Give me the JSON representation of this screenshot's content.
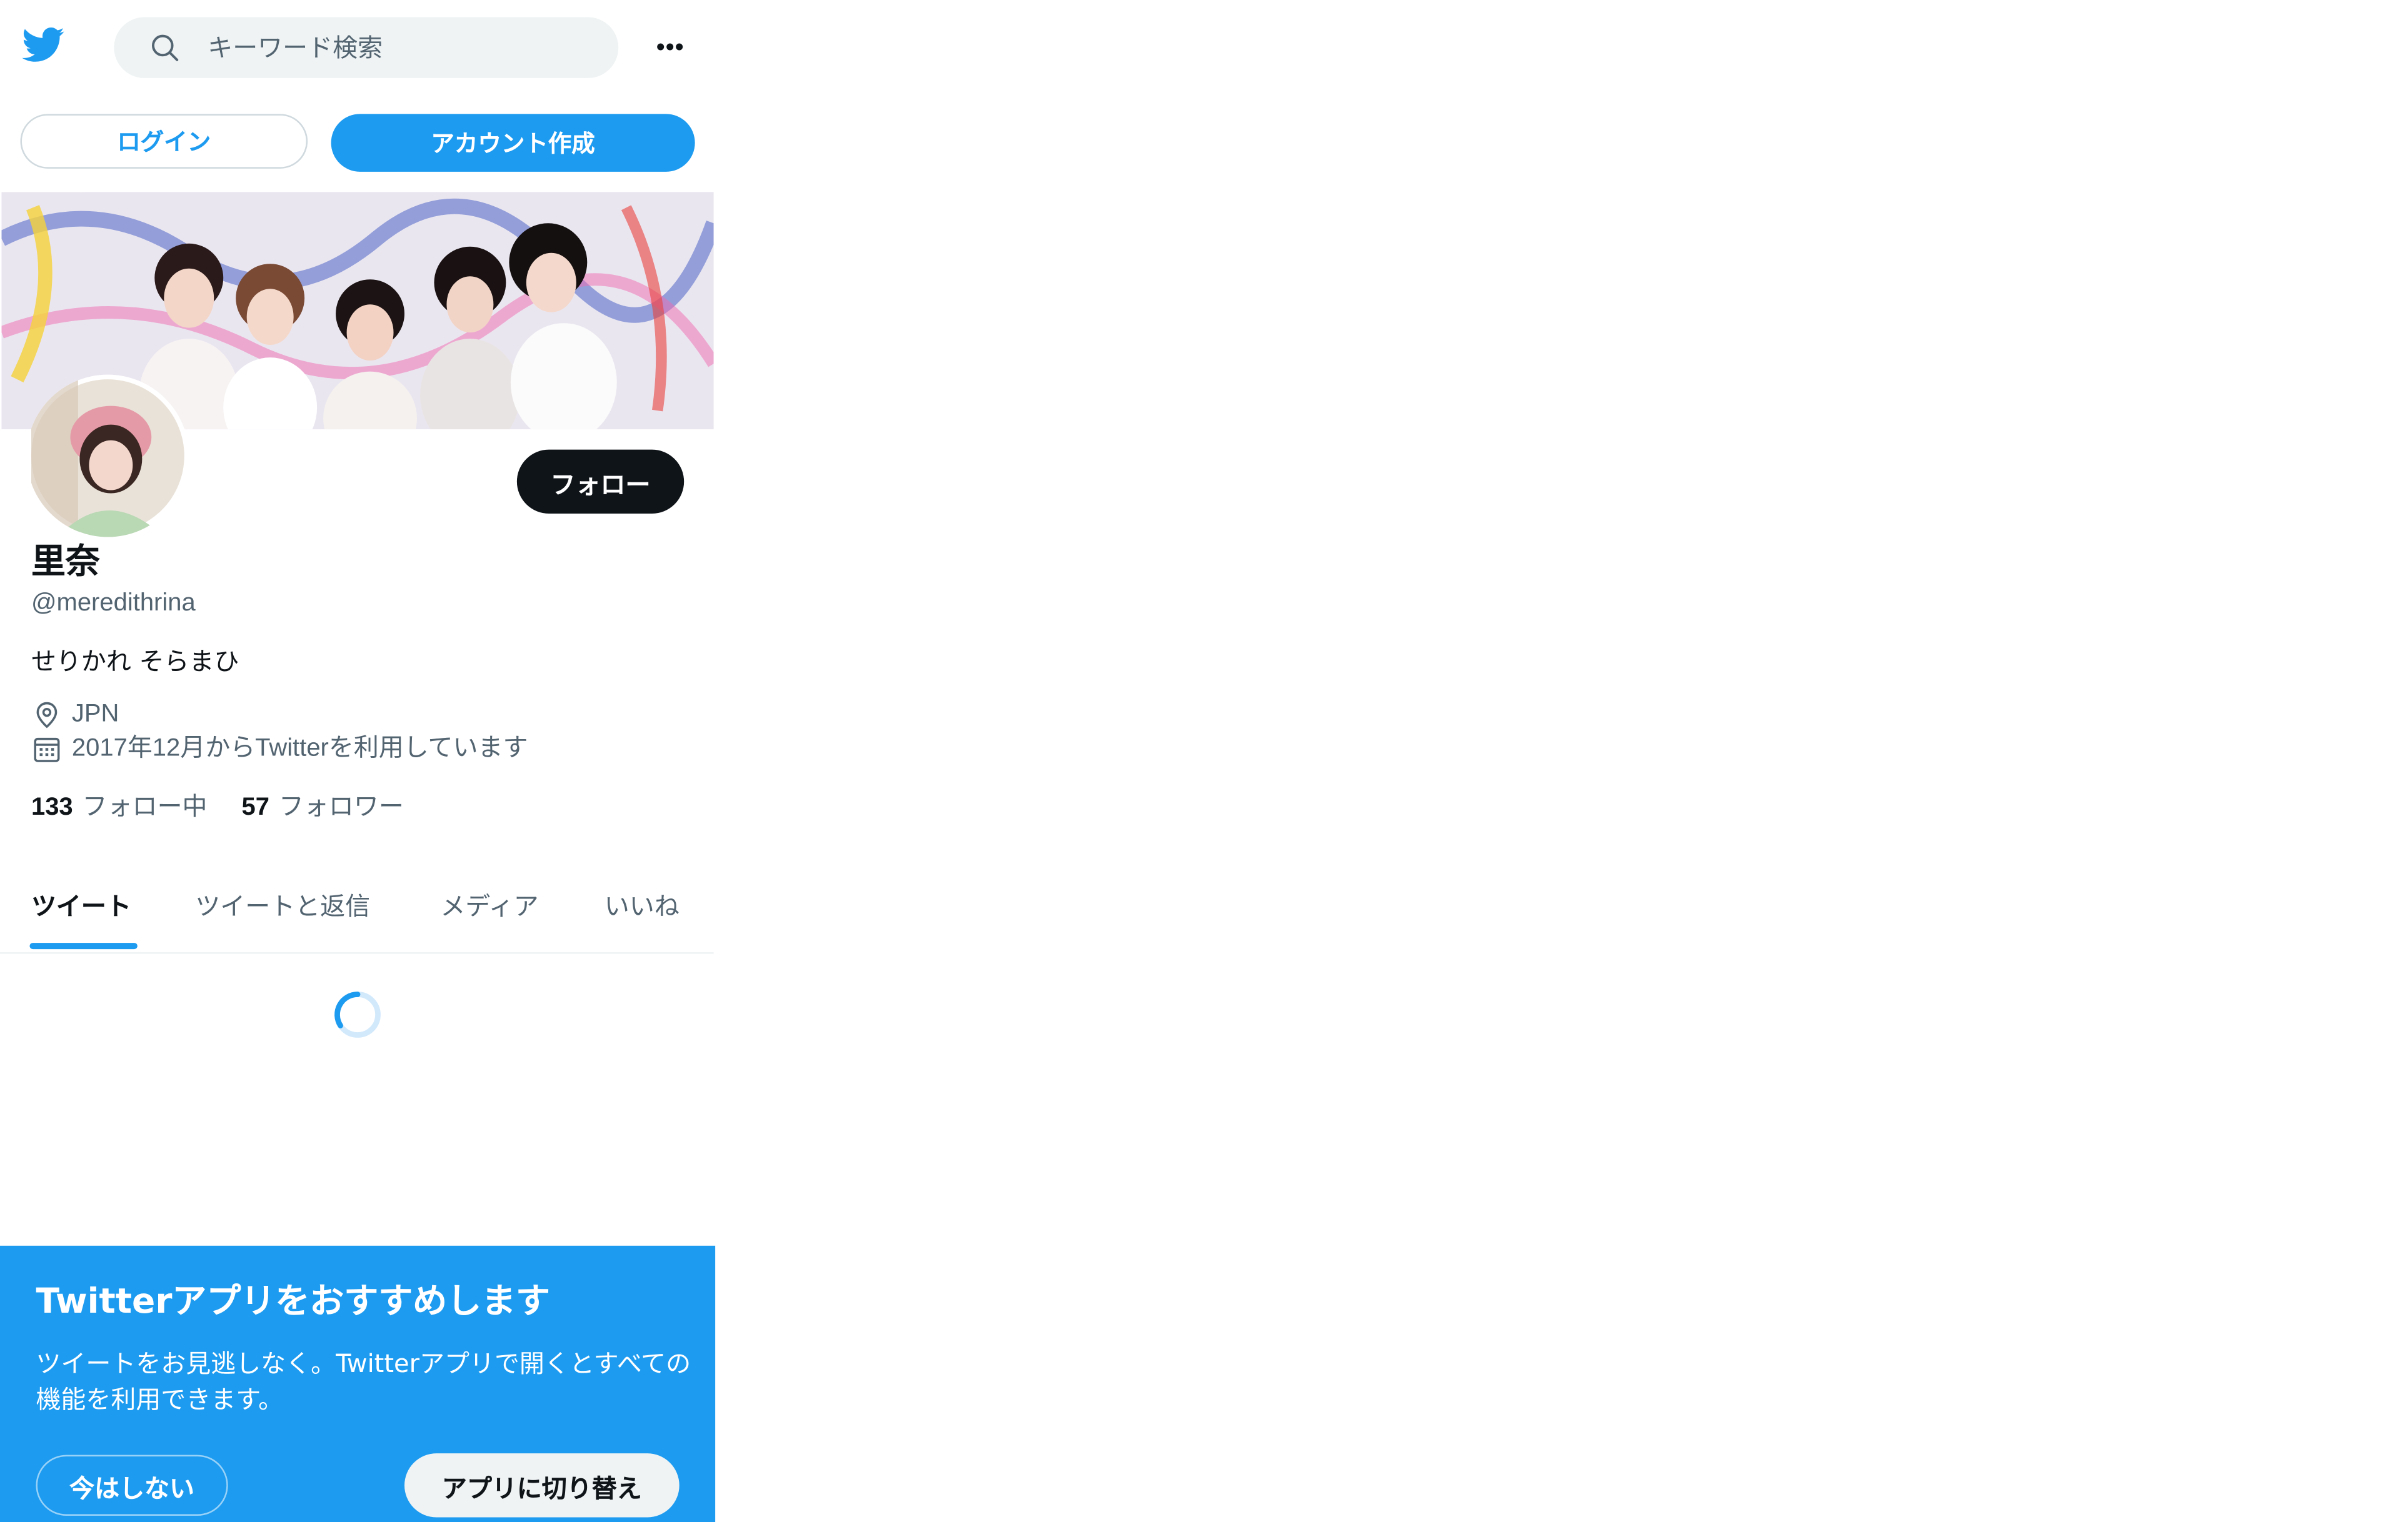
{
  "header": {
    "search_placeholder": "キーワード検索"
  },
  "auth": {
    "login_label": "ログイン",
    "signup_label": "アカウント作成"
  },
  "profile": {
    "follow_label": "フォロー",
    "display_name": "里奈",
    "handle": "@meredithrina",
    "bio": "せりかれ そらまひ",
    "location": "JPN",
    "joined": "2017年12月からTwitterを利用しています",
    "following_count": "133",
    "following_label": "フォロー中",
    "followers_count": "57",
    "followers_label": "フォロワー"
  },
  "tabs": [
    {
      "label": "ツイート",
      "active": true
    },
    {
      "label": "ツイートと返信",
      "active": false
    },
    {
      "label": "メディア",
      "active": false
    },
    {
      "label": "いいね",
      "active": false
    }
  ],
  "promo": {
    "title": "Twitterアプリをおすすめします",
    "body": "ツイートをお見逃しなく。Twitterアプリで開くとすべての機能を利用できます。",
    "not_now_label": "今はしない",
    "switch_label": "アプリに切り替え"
  },
  "colors": {
    "brand": "#1d9bf0",
    "text_primary": "#0f1419",
    "text_secondary": "#536471",
    "follow_button": "#0f1419"
  },
  "icons": [
    "twitter-bird-icon",
    "search-icon",
    "more-icon",
    "location-pin-icon",
    "calendar-icon",
    "loading-spinner"
  ]
}
